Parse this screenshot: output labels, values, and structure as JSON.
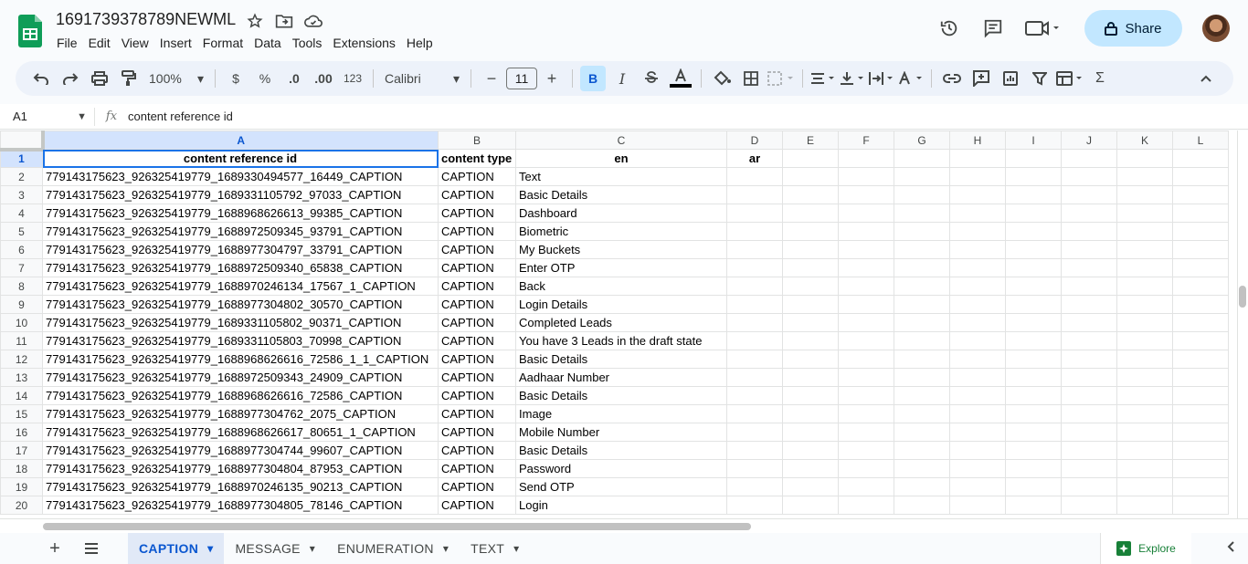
{
  "app": {
    "doc_title": "1691739378789NEWML",
    "menu": [
      "File",
      "Edit",
      "View",
      "Insert",
      "Format",
      "Data",
      "Tools",
      "Extensions",
      "Help"
    ],
    "share_label": "Share"
  },
  "toolbar": {
    "zoom": "100%",
    "currency": "$",
    "percent": "%",
    "dec_decrease": ".0",
    "dec_increase": ".00",
    "more_formats": "123",
    "font": "Calibri",
    "font_size": "11",
    "bold": "B",
    "italic": "I",
    "sum": "Σ"
  },
  "formula_bar": {
    "cell_ref": "A1",
    "fx": "fx",
    "value": "content reference id"
  },
  "columns": [
    "A",
    "B",
    "C",
    "D",
    "E",
    "F",
    "G",
    "H",
    "I",
    "J",
    "K",
    "L"
  ],
  "header_row": [
    "content reference id",
    "content type",
    "en",
    "ar"
  ],
  "rows": [
    [
      "779143175623_926325419779_1689330494577_16449_CAPTION",
      "CAPTION",
      "Text"
    ],
    [
      "779143175623_926325419779_1689331105792_97033_CAPTION",
      "CAPTION",
      "Basic Details"
    ],
    [
      "779143175623_926325419779_1688968626613_99385_CAPTION",
      "CAPTION",
      "Dashboard"
    ],
    [
      "779143175623_926325419779_1688972509345_93791_CAPTION",
      "CAPTION",
      "Biometric"
    ],
    [
      "779143175623_926325419779_1688977304797_33791_CAPTION",
      "CAPTION",
      "My Buckets"
    ],
    [
      "779143175623_926325419779_1688972509340_65838_CAPTION",
      "CAPTION",
      "Enter OTP"
    ],
    [
      "779143175623_926325419779_1688970246134_17567_1_CAPTION",
      "CAPTION",
      "Back"
    ],
    [
      "779143175623_926325419779_1688977304802_30570_CAPTION",
      "CAPTION",
      "Login Details"
    ],
    [
      "779143175623_926325419779_1689331105802_90371_CAPTION",
      "CAPTION",
      "Completed Leads"
    ],
    [
      "779143175623_926325419779_1689331105803_70998_CAPTION",
      "CAPTION",
      "You have 3 Leads in the draft state"
    ],
    [
      "779143175623_926325419779_1688968626616_72586_1_1_CAPTION",
      "CAPTION",
      "Basic Details"
    ],
    [
      "779143175623_926325419779_1688972509343_24909_CAPTION",
      "CAPTION",
      "Aadhaar Number"
    ],
    [
      "779143175623_926325419779_1688968626616_72586_CAPTION",
      "CAPTION",
      "Basic Details"
    ],
    [
      "779143175623_926325419779_1688977304762_2075_CAPTION",
      "CAPTION",
      "Image"
    ],
    [
      "779143175623_926325419779_1688968626617_80651_1_CAPTION",
      "CAPTION",
      "Mobile Number"
    ],
    [
      "779143175623_926325419779_1688977304744_99607_CAPTION",
      "CAPTION",
      "Basic Details"
    ],
    [
      "779143175623_926325419779_1688977304804_87953_CAPTION",
      "CAPTION",
      "Password"
    ],
    [
      "779143175623_926325419779_1688970246135_90213_CAPTION",
      "CAPTION",
      "Send OTP"
    ],
    [
      "779143175623_926325419779_1688977304805_78146_CAPTION",
      "CAPTION",
      "Login"
    ]
  ],
  "sheet_tabs": [
    "CAPTION",
    "MESSAGE",
    "ENUMERATION",
    "TEXT"
  ],
  "active_tab": "CAPTION",
  "explore_label": "Explore",
  "colors": {
    "accent": "#0b57d0",
    "share_bg": "#c2e7ff",
    "selection": "#d3e3fd",
    "sheets_green": "#0f9d58"
  }
}
